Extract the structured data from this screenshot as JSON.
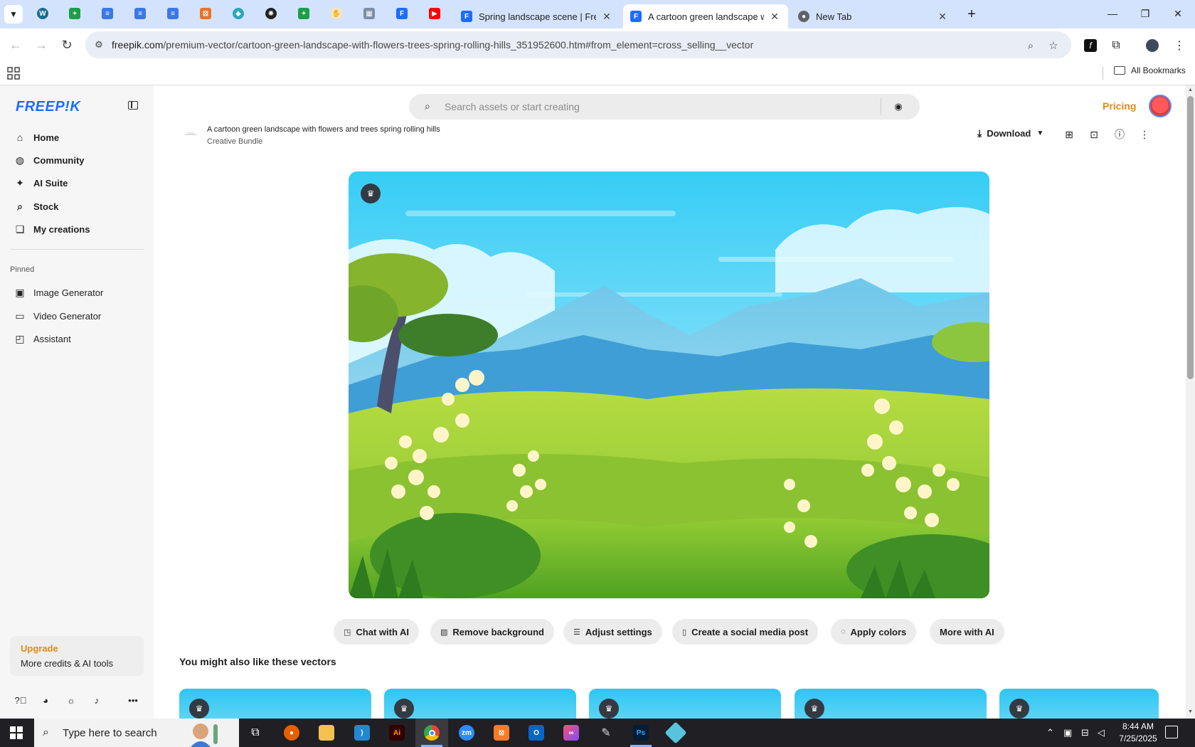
{
  "browser": {
    "tabs": [
      {
        "title": "Spring landscape scene | Free V",
        "active": false
      },
      {
        "title": "A cartoon green landscape with",
        "active": true
      },
      {
        "title": "New Tab",
        "active": false
      }
    ],
    "url_host": "freepik.com",
    "url_path": "/premium-vector/cartoon-green-landscape-with-flowers-trees-spring-rolling-hills_351952600.htm#from_element=cross_selling__vector",
    "bookmarks_all": "All Bookmarks"
  },
  "sidebar": {
    "logo": "FREEP!K",
    "nav": [
      {
        "label": "Home",
        "icon": "home-icon"
      },
      {
        "label": "Community",
        "icon": "globe-icon"
      },
      {
        "label": "AI Suite",
        "icon": "sparkle-icon"
      },
      {
        "label": "Stock",
        "icon": "search-icon"
      },
      {
        "label": "My creations",
        "icon": "stack-icon"
      }
    ],
    "pinned_label": "Pinned",
    "pinned": [
      {
        "label": "Image Generator",
        "icon": "image-icon"
      },
      {
        "label": "Video Generator",
        "icon": "video-icon"
      },
      {
        "label": "Assistant",
        "icon": "chat-icon"
      }
    ],
    "upgrade_title": "Upgrade",
    "upgrade_sub": "More credits & AI tools"
  },
  "header": {
    "search_placeholder": "Search assets or start creating",
    "pricing": "Pricing"
  },
  "resource": {
    "title": "A cartoon green landscape with flowers and trees spring rolling hills",
    "subtitle": "Creative Bundle",
    "download_label": "Download"
  },
  "ai_tools": [
    {
      "label": "Chat with AI",
      "icon": "chat-icon"
    },
    {
      "label": "Remove background",
      "icon": "eraser-icon"
    },
    {
      "label": "Adjust settings",
      "icon": "sliders-icon"
    },
    {
      "label": "Create a social media post",
      "icon": "phone-icon"
    },
    {
      "label": "Apply colors",
      "icon": "palette-icon"
    },
    {
      "label": "More with AI",
      "icon": ""
    }
  ],
  "related_title": "You might also like these vectors",
  "taskbar": {
    "search_text": "Type here to search",
    "time": "8:44 AM",
    "date": "7/25/2025"
  },
  "colors": {
    "brand_blue": "#1f6bff",
    "accent_orange": "#e08a14",
    "tab_strip": "#d3e3fd"
  }
}
